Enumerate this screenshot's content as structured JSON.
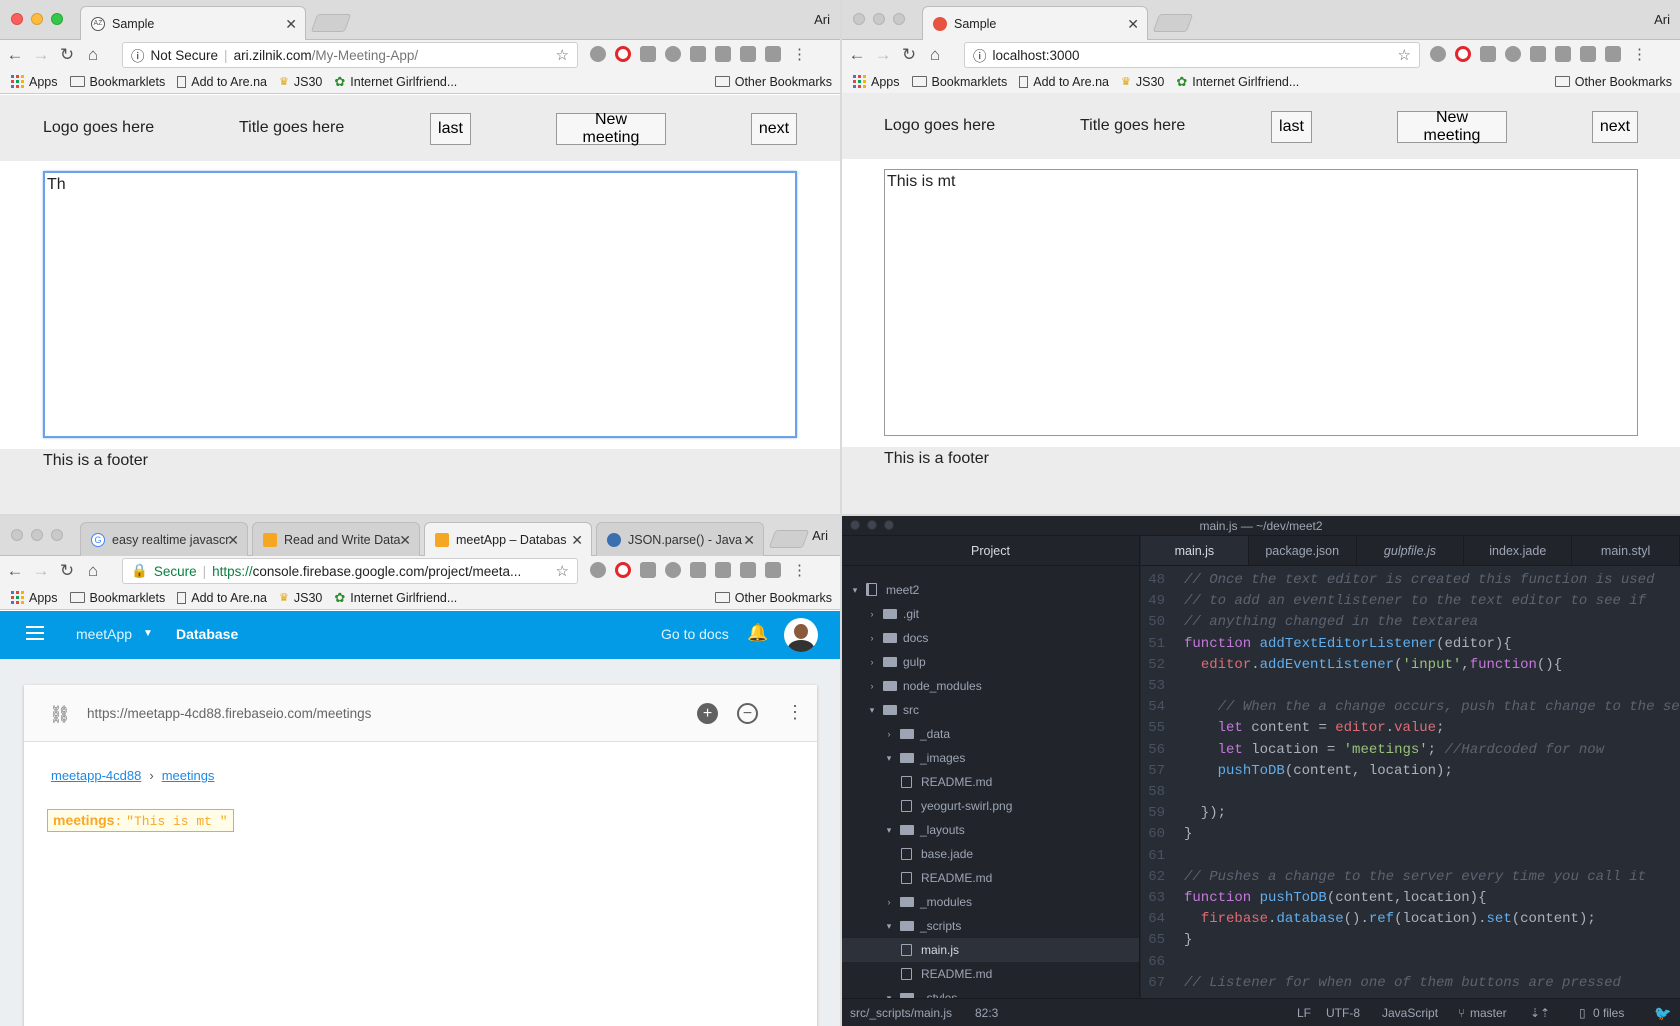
{
  "top_left": {
    "tab_title": "Sample",
    "profile": "Ari",
    "security": "Not Secure",
    "url_host": "ari.zilnik.com",
    "url_path": "/My-Meeting-App/",
    "favicon_label": "AZ",
    "page": {
      "logo": "Logo goes here",
      "title": "Title goes here",
      "last": "last",
      "new_meeting": "New meeting",
      "next": "next",
      "textarea_value": "Th",
      "footer": "This is a footer"
    }
  },
  "top_right": {
    "tab_title": "Sample",
    "profile": "Ari",
    "url": "localhost:3000",
    "page": {
      "logo": "Logo goes here",
      "title": "Title goes here",
      "last": "last",
      "new_meeting": "New meeting",
      "next": "next",
      "textarea_value": "This is mt",
      "footer": "This is a footer"
    }
  },
  "bookmarks": {
    "apps": "Apps",
    "bookmarklets": "Bookmarklets",
    "arena": "Add to Are.na",
    "js30": "JS30",
    "girlfriend": "Internet Girlfriend...",
    "other": "Other Bookmarks"
  },
  "bottom_left": {
    "profile": "Ari",
    "tabs": [
      "easy realtime javascr",
      "Read and Write Data",
      "meetApp – Databas",
      "JSON.parse() - Java"
    ],
    "security": "Secure",
    "url_scheme": "https://",
    "url_rest": "console.firebase.google.com/project/meeta...",
    "firebase": {
      "project": "meetApp",
      "section": "Database",
      "docs": "Go to docs",
      "db_url": "https://meetapp-4cd88.firebaseio.com/meetings",
      "crumb_root": "meetapp-4cd88",
      "crumb_sep": "›",
      "crumb_child": "meetings",
      "node_key": "meetings",
      "node_colon": ":",
      "node_value": "\"This is mt \""
    }
  },
  "atom": {
    "window_title": "main.js — ~/dev/meet2",
    "tree_header": "Project",
    "tabs": [
      "main.js",
      "package.json",
      "gulpfile.js",
      "index.jade",
      "main.styl"
    ],
    "tree": [
      {
        "label": "meet2"
      },
      {
        "label": ".git"
      },
      {
        "label": "docs"
      },
      {
        "label": "gulp"
      },
      {
        "label": "node_modules"
      },
      {
        "label": "src"
      },
      {
        "label": "_data"
      },
      {
        "label": "_images"
      },
      {
        "label": "README.md"
      },
      {
        "label": "yeogurt-swirl.png"
      },
      {
        "label": "_layouts"
      },
      {
        "label": "base.jade"
      },
      {
        "label": "README.md"
      },
      {
        "label": "_modules"
      },
      {
        "label": "_scripts"
      },
      {
        "label": "main.js"
      },
      {
        "label": "README.md"
      },
      {
        "label": "_styles"
      }
    ],
    "code": [
      {
        "n": "48",
        "t": "// Once the text editor is created this function is used"
      },
      {
        "n": "49",
        "t": "// to add an eventlistener to the text editor to see if"
      },
      {
        "n": "50",
        "t": "// anything changed in the textarea"
      },
      {
        "n": "51",
        "t": "function addTextEditorListener(editor){"
      },
      {
        "n": "52",
        "t": "  editor.addEventListener('input',function(){"
      },
      {
        "n": "53",
        "t": ""
      },
      {
        "n": "54",
        "t": "    // When the a change occurs, push that change to the se"
      },
      {
        "n": "55",
        "t": "    let content = editor.value;"
      },
      {
        "n": "56",
        "t": "    let location = 'meetings'; //Hardcoded for now"
      },
      {
        "n": "57",
        "t": "    pushToDB(content, location);"
      },
      {
        "n": "58",
        "t": ""
      },
      {
        "n": "59",
        "t": "  });"
      },
      {
        "n": "60",
        "t": "}"
      },
      {
        "n": "61",
        "t": ""
      },
      {
        "n": "62",
        "t": "// Pushes a change to the server every time you call it"
      },
      {
        "n": "63",
        "t": "function pushToDB(content,location){"
      },
      {
        "n": "64",
        "t": "  firebase.database().ref(location).set(content);"
      },
      {
        "n": "65",
        "t": "}"
      },
      {
        "n": "66",
        "t": ""
      },
      {
        "n": "67",
        "t": "// Listener for when one of them buttons are pressed"
      }
    ],
    "status": {
      "path": "src/_scripts/main.js",
      "cursor": "82:3",
      "eol": "LF",
      "encoding": "UTF-8",
      "grammar": "JavaScript",
      "branch": "master",
      "files": "0 files"
    }
  }
}
